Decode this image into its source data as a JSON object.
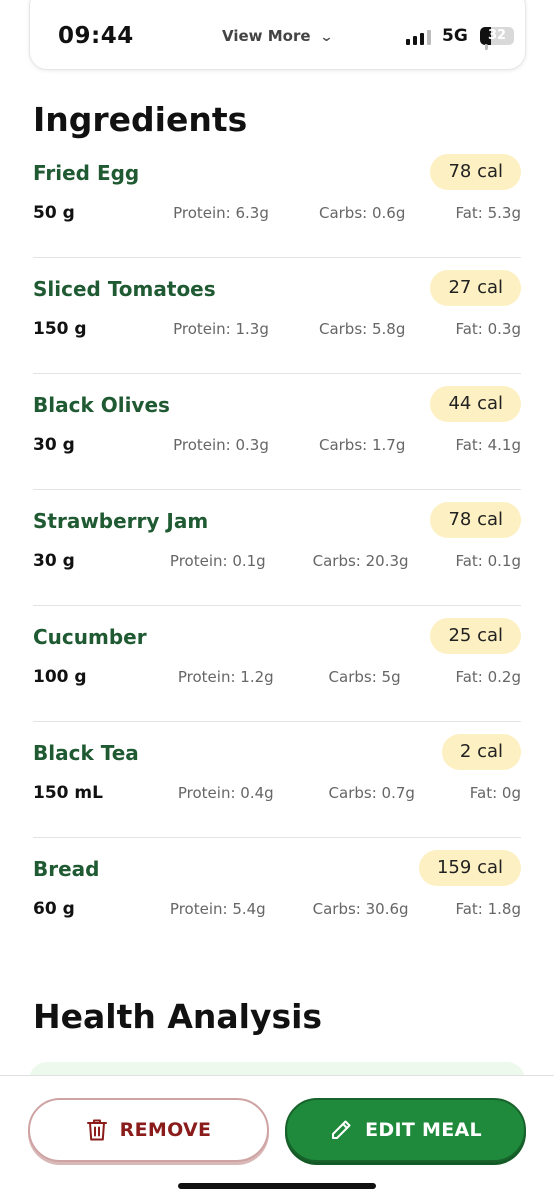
{
  "status_bar": {
    "time": "09:44",
    "center_label": "View More",
    "network": "5G",
    "battery": "32",
    "battery_level_percent": 32
  },
  "ingredients": {
    "title": "Ingredients",
    "items": [
      {
        "name": "Fried Egg",
        "calories": "78 cal",
        "quantity": "50 g",
        "protein": "Protein: 6.3g",
        "carbs": "Carbs: 0.6g",
        "fat": "Fat: 5.3g"
      },
      {
        "name": "Sliced Tomatoes",
        "calories": "27 cal",
        "quantity": "150 g",
        "protein": "Protein: 1.3g",
        "carbs": "Carbs: 5.8g",
        "fat": "Fat: 0.3g"
      },
      {
        "name": "Black Olives",
        "calories": "44 cal",
        "quantity": "30 g",
        "protein": "Protein: 0.3g",
        "carbs": "Carbs: 1.7g",
        "fat": "Fat: 4.1g"
      },
      {
        "name": "Strawberry Jam",
        "calories": "78 cal",
        "quantity": "30 g",
        "protein": "Protein: 0.1g",
        "carbs": "Carbs: 20.3g",
        "fat": "Fat: 0.1g"
      },
      {
        "name": "Cucumber",
        "calories": "25 cal",
        "quantity": "100 g",
        "protein": "Protein: 1.2g",
        "carbs": "Carbs: 5g",
        "fat": "Fat: 0.2g"
      },
      {
        "name": "Black Tea",
        "calories": "2 cal",
        "quantity": "150 mL",
        "protein": "Protein: 0.4g",
        "carbs": "Carbs: 0.7g",
        "fat": "Fat: 0g"
      },
      {
        "name": "Bread",
        "calories": "159 cal",
        "quantity": "60 g",
        "protein": "Protein: 5.4g",
        "carbs": "Carbs: 30.6g",
        "fat": "Fat: 1.8g"
      }
    ]
  },
  "health_analysis": {
    "title": "Health Analysis"
  },
  "actions": {
    "remove_label": "REMOVE",
    "edit_label": "EDIT MEAL"
  },
  "colors": {
    "ingredient_name": "#1f5a32",
    "calorie_badge": "#fdf0c2",
    "edit_button": "#1f8a3c",
    "remove_text": "#8b1c1c"
  },
  "icons": {
    "remove": "trash-icon",
    "edit": "pencil-icon",
    "view_more": "chevron-down-icon",
    "signal": "signal-icon"
  }
}
